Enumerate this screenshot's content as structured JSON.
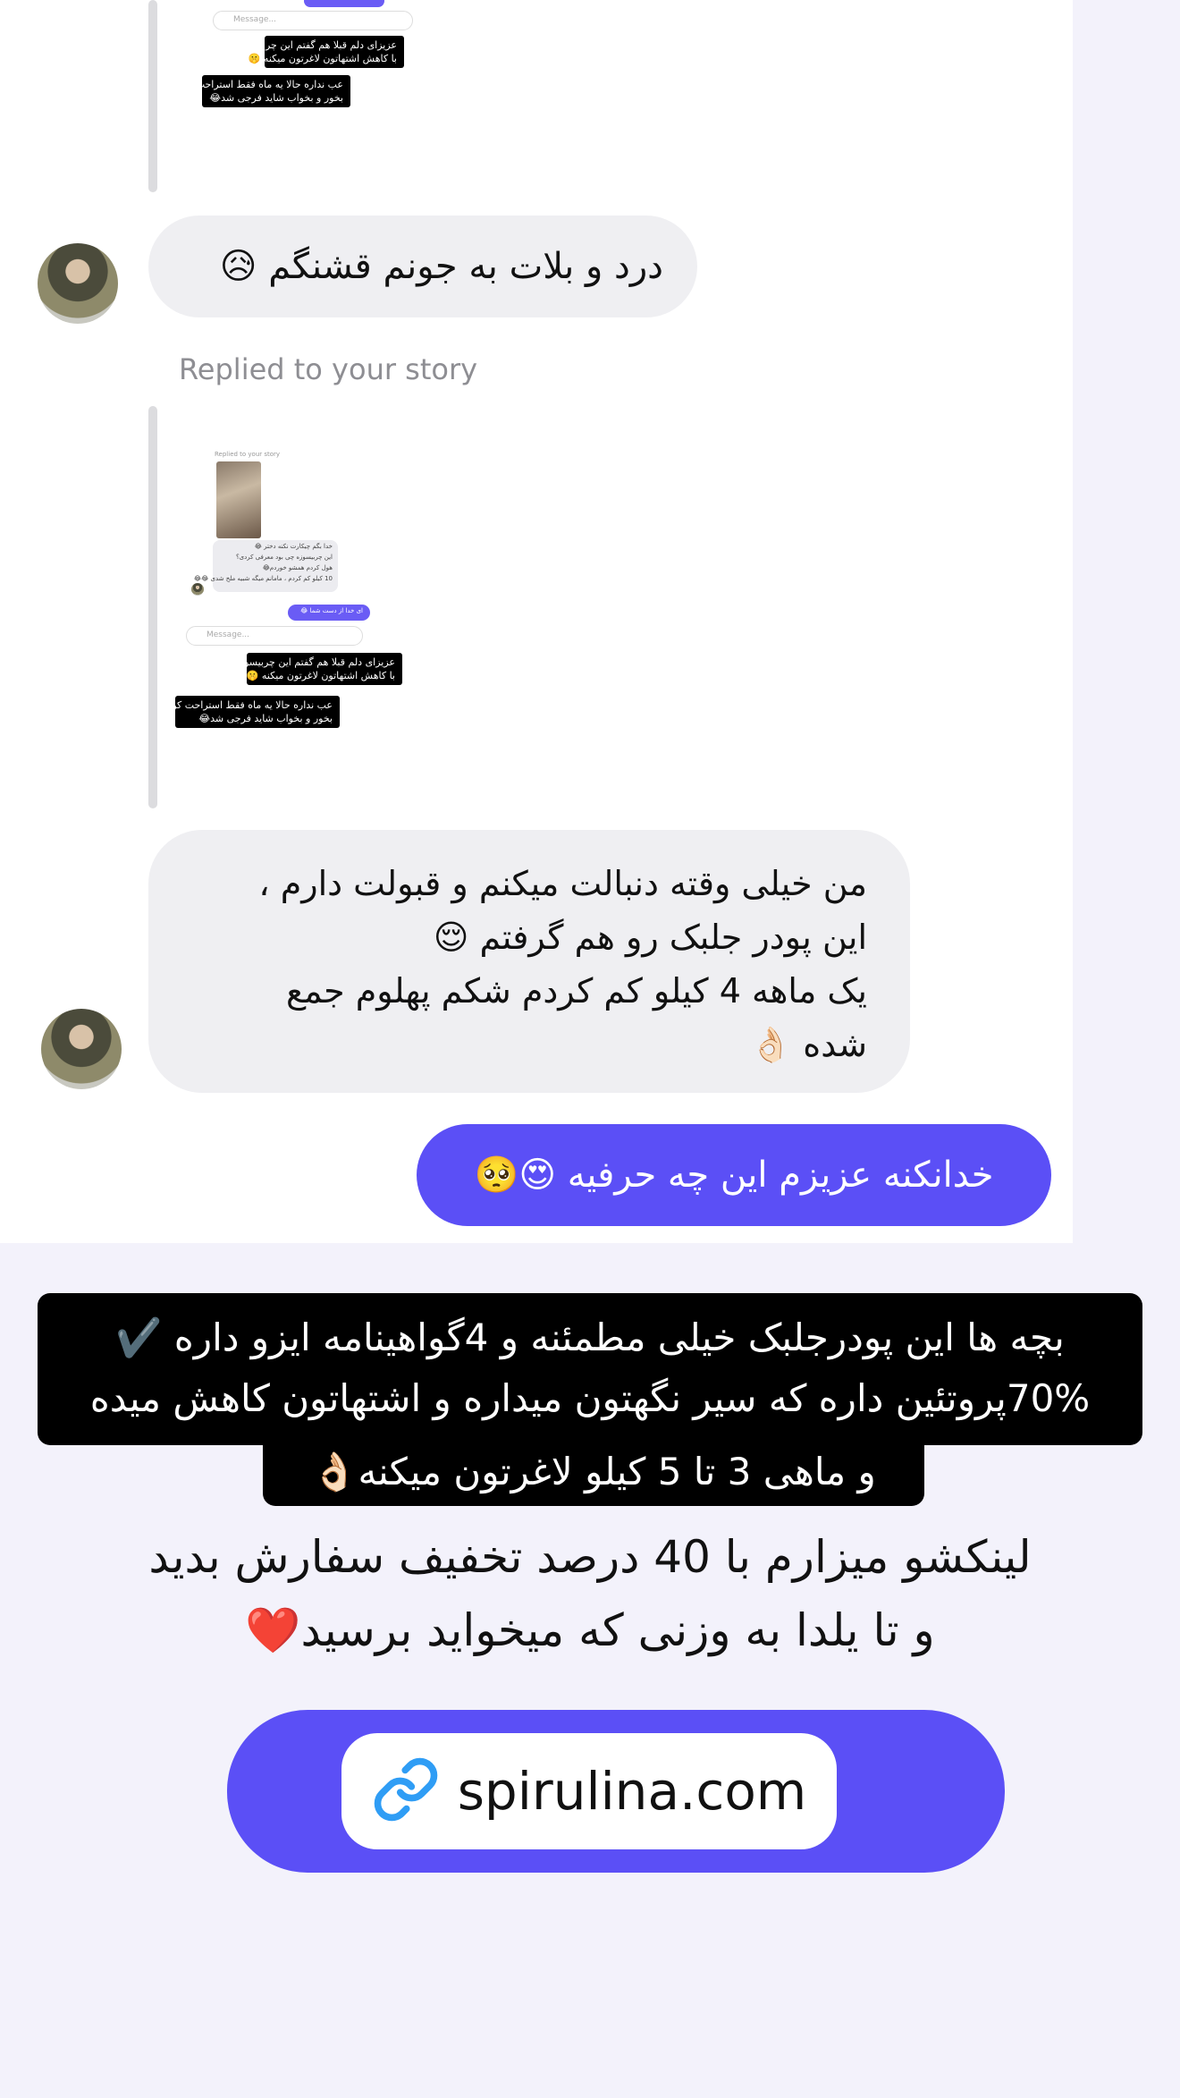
{
  "story1": {
    "message_placeholder": "Message...",
    "caption_line1": "عزیزای دلم قبلا هم گفتم این چربیسوز",
    "caption_line2": "با کاهش اشتهاتون لاغرتون میکنه 🤫",
    "caption_line3": "عب نداره حالا یه ماه فقط استراحت کن",
    "caption_line4": "بخور و بخواب شاید فرجی شد😂"
  },
  "message1": {
    "text": "درد و بلات به جونم قشنگم 😥"
  },
  "reply_label": "Replied to your story",
  "story2": {
    "replied_label": "Replied to your story",
    "bubble_line1": "خدا بگم چیکارت نکنه دختر 😂",
    "bubble_line2": "این چربیسوزه چی بود معرفی کردی؟",
    "bubble_line3": "هول کردم همشو خوردم😂",
    "bubble_line4": "10 کیلو کم کردم ، مامانم میگه شبیه ملخ شدی 😂😂",
    "purple_text": "ای خدا از دست شما 😂",
    "message_placeholder": "Message...",
    "caption_line1": "عزیزای دلم قبلا هم گفتم این چربیسوز",
    "caption_line2": "با کاهش اشتهاتون لاغرتون میکنه 🤫",
    "caption_line3": "عب نداره حالا یه ماه فقط استراحت کن",
    "caption_line4": "بخور و بخواب شاید فرجی شد😂"
  },
  "message2": {
    "line1": "من خیلی وقته دنبالت میکنم و قبولت دارم ،",
    "line2": "این پودر جلبک رو هم گرفتم 😌",
    "line3": "یک ماهه 4 کیلو کم کردم شکم پهلوم جمع",
    "line4": "شده 👌🏻"
  },
  "reply_out": {
    "text": "خدانکنه عزیزم این چه حرفیه 😍🥺"
  },
  "caption_box": {
    "line1": "بچه ها این پودرجلبک خیلی مطمئنه و 4گواهینامه ایزو داره ✔️",
    "line2": "70%پروتئین داره که سیر نگهتون میداره و اشتهاتون کاهش میده",
    "line3": "و ماهی 3 تا 5 کیلو لاغرتون میکنه👌🏻"
  },
  "promo": {
    "line1": "لینکشو میزارم با 40 درصد تخفیف سفارش بدید",
    "line2": "و تا یلدا به وزنی که میخواید برسید❤️"
  },
  "link_sticker": {
    "url": "spirulina.com",
    "icon": "link-icon"
  },
  "colors": {
    "accent": "#5b4ff6",
    "bubble_in": "#efeff2",
    "background": "#f3f2fb"
  }
}
